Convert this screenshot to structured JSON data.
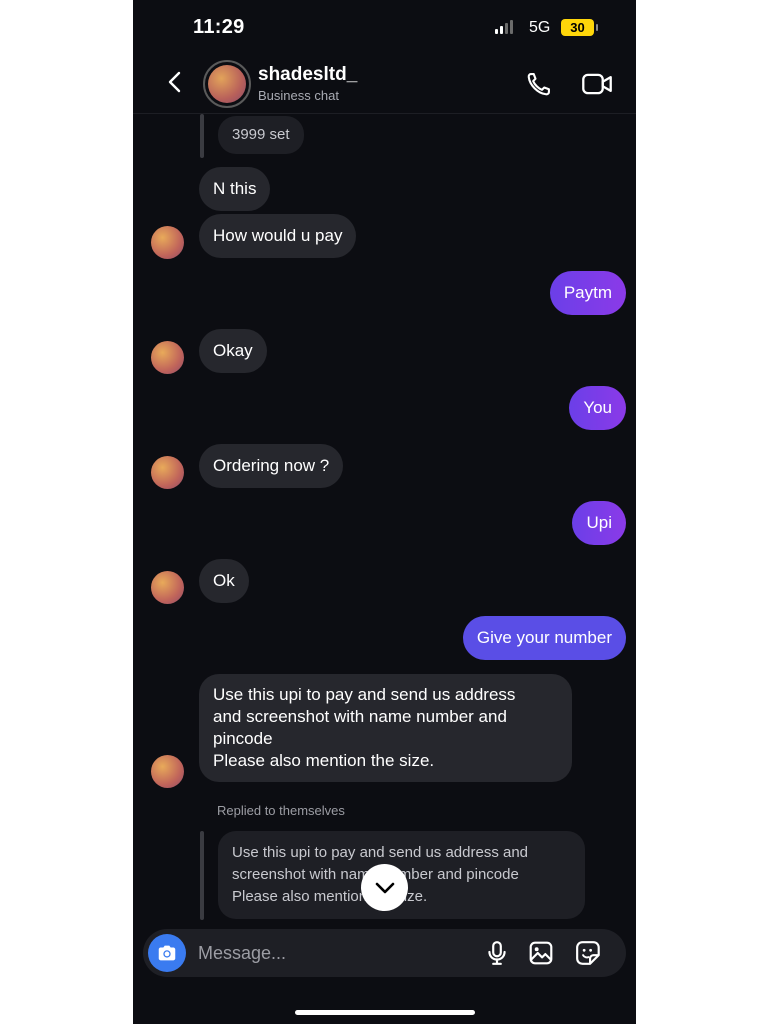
{
  "status_bar": {
    "time": "11:29",
    "network": "5G",
    "battery": "30"
  },
  "header": {
    "name": "shadesltd_",
    "subtitle": "Business chat",
    "icons": [
      "back-icon",
      "phone-icon",
      "video-call-icon"
    ]
  },
  "messages": [
    {
      "type": "quoted",
      "text": "3999 set"
    },
    {
      "type": "incoming",
      "text": "N this"
    },
    {
      "type": "incoming",
      "text": "How would u pay"
    },
    {
      "type": "outgoing",
      "text": "Paytm"
    },
    {
      "type": "incoming",
      "text": "Okay"
    },
    {
      "type": "outgoing",
      "text": "You"
    },
    {
      "type": "incoming",
      "text": "Ordering now ?"
    },
    {
      "type": "outgoing",
      "text": "Upi"
    },
    {
      "type": "incoming",
      "text": "Ok"
    },
    {
      "type": "outgoing",
      "text": "Give your number"
    },
    {
      "type": "incoming",
      "lines": [
        "Use this upi to pay and send us address",
        "and screenshot with name number and",
        "pincode",
        "Please also mention the size."
      ]
    }
  ],
  "reply": {
    "label": "Replied to themselves",
    "lines": [
      "Use this upi to pay and send us address and",
      "screenshot with name number and pincode",
      "Please also mention the size."
    ]
  },
  "composer": {
    "placeholder": "Message..."
  },
  "colors": {
    "background": "#0c0d12",
    "incoming_bubble": "#26272d",
    "outgoing_bubble": "#7b3ce8",
    "camera_button": "#3a7bf0",
    "battery": "#ffd60a"
  }
}
